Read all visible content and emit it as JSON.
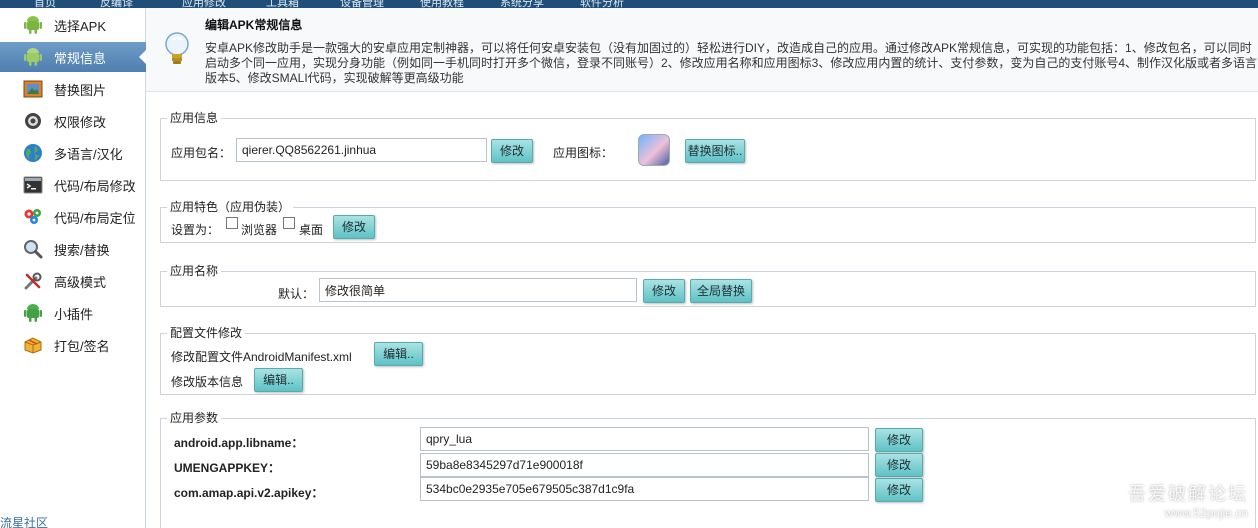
{
  "topnav": [
    "首页",
    "反编译",
    "应用修改",
    "工具箱",
    "设备管理",
    "使用教程",
    "系统分享",
    "软件分析"
  ],
  "sidebar": {
    "items": [
      {
        "label": "选择APK",
        "icon": "android-icon",
        "active": false
      },
      {
        "label": "常规信息",
        "icon": "android-icon",
        "active": true
      },
      {
        "label": "替换图片",
        "icon": "picture-icon",
        "active": false
      },
      {
        "label": "权限修改",
        "icon": "shield-icon",
        "active": false
      },
      {
        "label": "多语言/汉化",
        "icon": "globe-icon",
        "active": false
      },
      {
        "label": "代码/布局修改",
        "icon": "terminal-icon",
        "active": false
      },
      {
        "label": "代码/布局定位",
        "icon": "location-pin-icon",
        "active": false
      },
      {
        "label": "搜索/替换",
        "icon": "magnifier-icon",
        "active": false
      },
      {
        "label": "高级模式",
        "icon": "tools-icon",
        "active": false
      },
      {
        "label": "小插件",
        "icon": "android-icon",
        "active": false
      },
      {
        "label": "打包/签名",
        "icon": "package-icon",
        "active": false
      }
    ],
    "footer_link": "流星社区"
  },
  "header": {
    "title": "编辑APK常规信息",
    "description": "安卓APK修改助手是一款强大的安卓应用定制神器，可以将任何安卓安装包（没有加固过的）轻松进行DIY，改造成自己的应用。通过修改APK常规信息，可实现的功能包括：1、修改包名，可以同时启动多个同一应用，实现分身功能（例如同一手机同时打开多个微信，登录不同账号）2、修改应用名称和应用图标3、修改应用内置的统计、支付参数，变为自己的支付账号4、制作汉化版或者多语言版本5、修改SMALI代码，实现破解等更高级功能"
  },
  "app_info": {
    "title": "应用信息",
    "package_label": "应用包名：",
    "package_value": "qierer.QQ8562261.jinhua",
    "modify_btn": "修改",
    "icon_label": "应用图标：",
    "replace_icon_btn": "替换图标.."
  },
  "app_feature": {
    "title": "应用特色（应用伪装）",
    "set_label": "设置为：",
    "browser_label": "浏览器",
    "browser_checked": false,
    "desktop_label": "桌面",
    "desktop_checked": false,
    "modify_btn": "修改"
  },
  "app_name": {
    "title": "应用名称",
    "default_label": "默认：",
    "default_value": "修改很简单",
    "modify_btn": "修改",
    "global_replace_btn": "全局替换"
  },
  "config_file": {
    "title": "配置文件修改",
    "manifest_label": "修改配置文件AndroidManifest.xml",
    "manifest_btn": "编辑..",
    "version_label": "修改版本信息",
    "version_btn": "编辑.."
  },
  "app_params": {
    "title": "应用参数",
    "rows": [
      {
        "key": "android.app.libname：",
        "value": "qpry_lua",
        "btn": "修改"
      },
      {
        "key": "UMENGAPPKEY：",
        "value": "59ba8e8345297d71e900018f",
        "btn": "修改"
      },
      {
        "key": "com.amap.api.v2.apikey：",
        "value": "534bc0e2935e705e679505c387d1c9fa",
        "btn": "修改"
      }
    ]
  },
  "watermark": {
    "line1": "吾爱破解论坛",
    "line2": "www.52pojie.cn"
  }
}
